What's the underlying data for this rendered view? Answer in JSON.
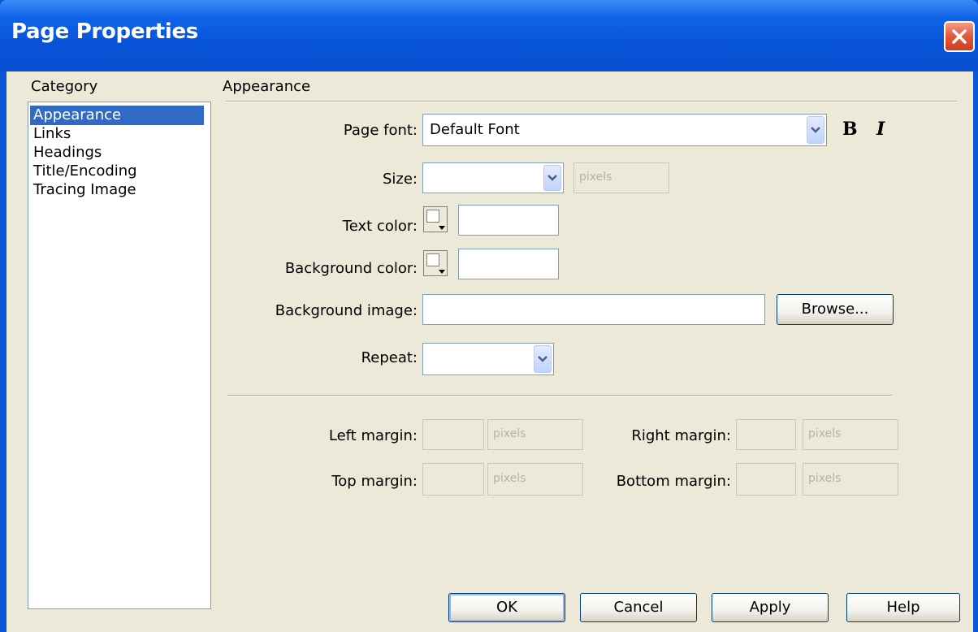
{
  "window": {
    "title": "Page Properties"
  },
  "category": {
    "label": "Category",
    "items": [
      "Appearance",
      "Links",
      "Headings",
      "Title/Encoding",
      "Tracing Image"
    ],
    "selected": "Appearance"
  },
  "section": {
    "title": "Appearance"
  },
  "form": {
    "page_font": {
      "label": "Page font:",
      "value": "Default Font"
    },
    "bold": "B",
    "italic": "I",
    "size": {
      "label": "Size:",
      "value": "",
      "unit": "pixels"
    },
    "text_color": {
      "label": "Text color:",
      "value": ""
    },
    "background_color": {
      "label": "Background color:",
      "value": ""
    },
    "background_image": {
      "label": "Background image:",
      "value": "",
      "browse": "Browse..."
    },
    "repeat": {
      "label": "Repeat:",
      "value": ""
    },
    "left_margin": {
      "label": "Left margin:",
      "value": "",
      "unit": "pixels"
    },
    "right_margin": {
      "label": "Right margin:",
      "value": "",
      "unit": "pixels"
    },
    "top_margin": {
      "label": "Top margin:",
      "value": "",
      "unit": "pixels"
    },
    "bottom_margin": {
      "label": "Bottom margin:",
      "value": "",
      "unit": "pixels"
    }
  },
  "buttons": {
    "ok": "OK",
    "cancel": "Cancel",
    "apply": "Apply",
    "help": "Help"
  },
  "colors": {
    "title_bar": "#0a58d8",
    "dialog_bg": "#ece9d8",
    "selection": "#316ac5",
    "close": "#e2593b"
  }
}
